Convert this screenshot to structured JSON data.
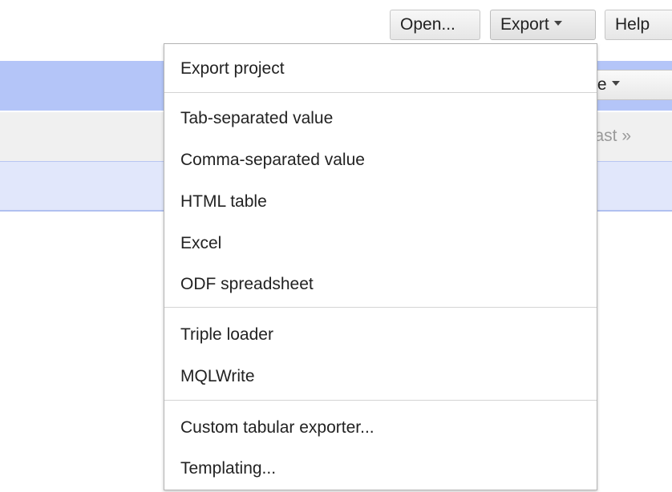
{
  "toolbar": {
    "open_label": "Open...",
    "export_label": "Export",
    "help_label": "Help"
  },
  "background": {
    "freebase_button_fragment": "base",
    "pager_fragment": "› last »"
  },
  "export_menu": {
    "groups": [
      {
        "items": [
          "Export project"
        ]
      },
      {
        "items": [
          "Tab-separated value",
          "Comma-separated value",
          "HTML table",
          "Excel",
          "ODF spreadsheet"
        ]
      },
      {
        "items": [
          "Triple loader",
          "MQLWrite"
        ]
      },
      {
        "items": [
          "Custom tabular exporter...",
          "Templating..."
        ]
      }
    ]
  }
}
